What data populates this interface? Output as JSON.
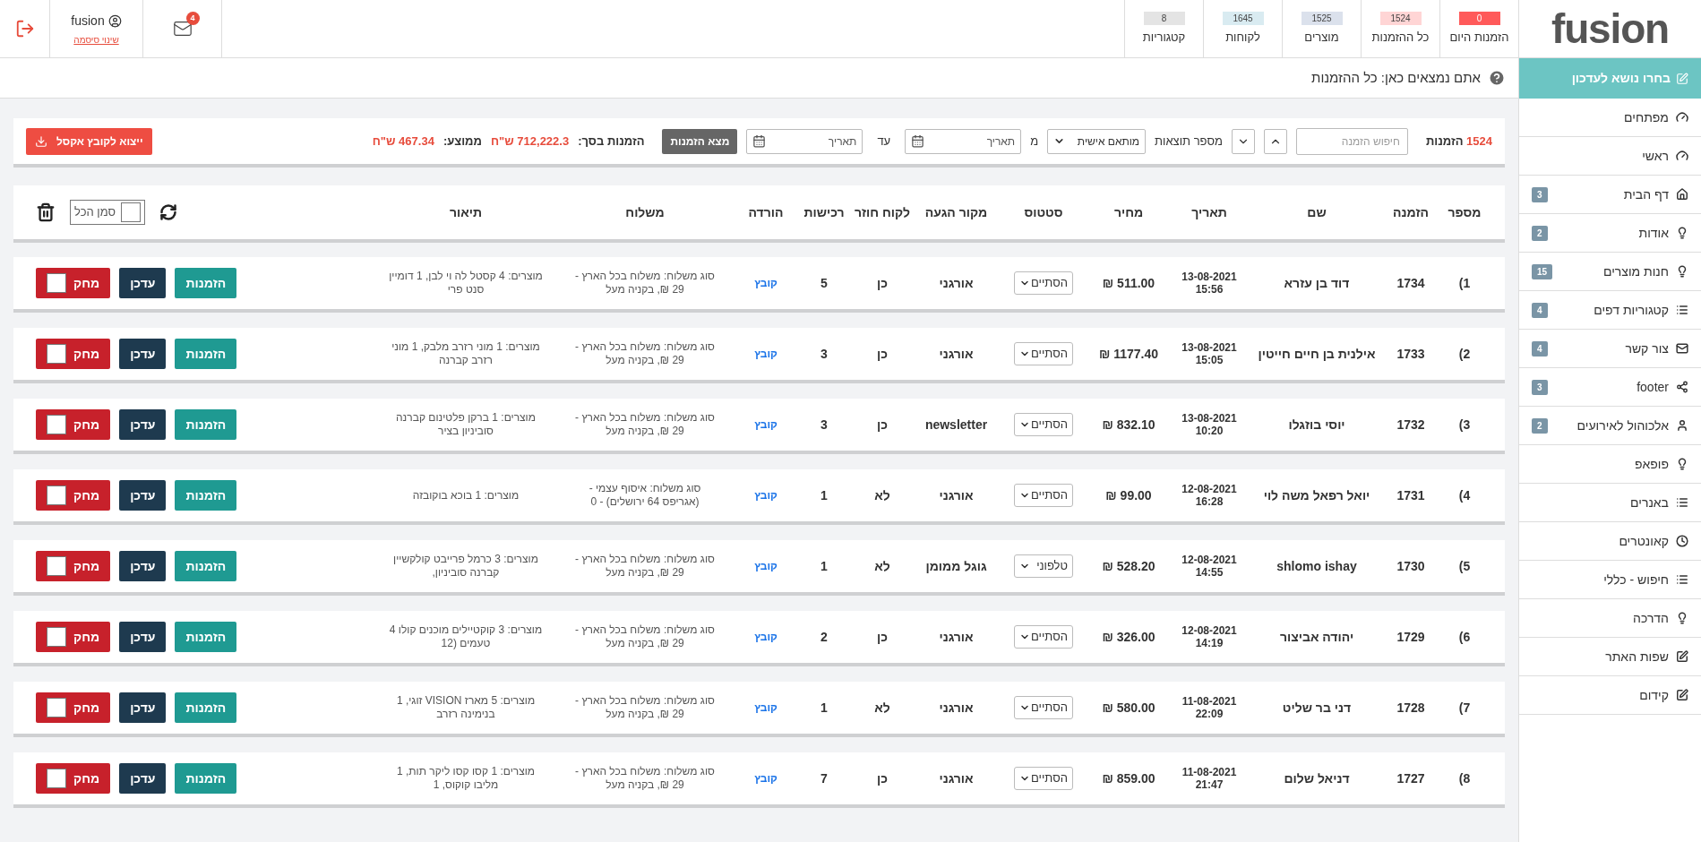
{
  "logo": "fusion",
  "stats": [
    {
      "label": "הזמנות היום",
      "value": "0",
      "color": "#ff5a5a"
    },
    {
      "label": "כל ההזמנות",
      "value": "1524",
      "color": "#ffd5d5"
    },
    {
      "label": "מוצרים",
      "value": "1525",
      "color": "#dbe1ec"
    },
    {
      "label": "לקוחות",
      "value": "1645",
      "color": "#d9ebf1"
    },
    {
      "label": "קטגוריות",
      "value": "8",
      "color": "#e4e4e4"
    }
  ],
  "user": {
    "name": "fusion",
    "link": "שינוי סיסמה"
  },
  "messages_badge": "4",
  "breadcrumb": "אתם נמצאים כאן: כל ההזמנות",
  "sidebar": {
    "title": "בחרו נושא לעדכון",
    "items": [
      {
        "label": "מפתחים",
        "kind": "dashboard"
      },
      {
        "label": "ראשי",
        "kind": "dashboard"
      },
      {
        "label": "דף הבית",
        "kind": "home",
        "badge": "3"
      },
      {
        "label": "אודות",
        "kind": "bulb",
        "badge": "2"
      },
      {
        "label": "חנות מוצרים",
        "kind": "bulb",
        "badge": "15"
      },
      {
        "label": "קטגוריות דפים",
        "kind": "list",
        "badge": "4"
      },
      {
        "label": "צור קשר",
        "kind": "mail",
        "badge": "4"
      },
      {
        "label": "footer",
        "kind": "share",
        "badge": "3"
      },
      {
        "label": "אלכוהול לאירועים",
        "kind": "user",
        "badge": "2"
      },
      {
        "label": "פופאפ",
        "kind": "bulb"
      },
      {
        "label": "באנרים",
        "kind": "list"
      },
      {
        "label": "קאונטרים",
        "kind": "clock"
      },
      {
        "label": "חיפוש - כללי",
        "kind": "list"
      },
      {
        "label": "הדרכה",
        "kind": "bulb"
      },
      {
        "label": "שפות האתר",
        "kind": "edit"
      },
      {
        "label": "קידום",
        "kind": "edit"
      }
    ]
  },
  "toolbar": {
    "count": "1524",
    "count_label": "הזמנות",
    "search_placeholder": "חיפוש הזמנה",
    "results_label": "מספר תוצאות",
    "results_select": "מותאם אישית",
    "from_label": "מ",
    "from_placeholder": "תאריך",
    "to_label": "עד",
    "to_placeholder": "תאריך",
    "find_button": "מצא הזמנות",
    "total_label": "הזמנות בסך:",
    "total_value": "712,222.3 ש\"ח",
    "average_label": "ממוצע:",
    "average_value": "467.34 ש\"ח",
    "export_button": "ייצוא לקובץ אקסל"
  },
  "table": {
    "columns": [
      "מספר",
      "הזמנה",
      "שם",
      "תאריך",
      "מחיר",
      "סטטוס",
      "מקור הגעה",
      "לקוח חוזר",
      "רכישות",
      "הורדה",
      "משלוח",
      "תיאור"
    ],
    "select_all": {
      "label": "סמן הכל",
      "checked": false
    },
    "rows": [
      {
        "index": "1)",
        "order": "1734",
        "name": "דוד בן עזרא",
        "date": "13-08-2021",
        "time": "15:56",
        "price": "511.00 ₪",
        "status": "הסתיים",
        "source": "אורגני",
        "returning": "כן",
        "purchases": "5",
        "download": "קובץ",
        "shipping": "סוג משלוח: משלוח בכל הארץ - 29 ₪, בקניה מעל",
        "description": "מוצרים: 4 קסטל לה וי לבן, 1 דומיין סנט פרי",
        "buttons": [
          "הזמנות",
          "עדכן",
          "מחק"
        ],
        "checked": false
      },
      {
        "index": "2)",
        "order": "1733",
        "name": "אילנית בן חיים חייטין",
        "date": "13-08-2021",
        "time": "15:05",
        "price": "1177.40 ₪",
        "status": "הסתיים",
        "source": "אורגני",
        "returning": "כן",
        "purchases": "3",
        "download": "קובץ",
        "shipping": "סוג משלוח: משלוח בכל הארץ - 29 ₪, בקניה מעל",
        "description": "מוצרים: 1 מוני רזרב מלבק, 1 מוני רזרב קברנה",
        "buttons": [
          "הזמנות",
          "עדכן",
          "מחק"
        ],
        "checked": false
      },
      {
        "index": "3)",
        "order": "1732",
        "name": "יוסי בוזגלו",
        "date": "13-08-2021",
        "time": "10:20",
        "price": "832.10 ₪",
        "status": "הסתיים",
        "source": "newsletter",
        "returning": "כן",
        "purchases": "3",
        "download": "קובץ",
        "shipping": "סוג משלוח: משלוח בכל הארץ - 29 ₪, בקניה מעל",
        "description": "מוצרים: 1 ברקן פלטינום קברנה סוביניון בציר",
        "buttons": [
          "הזמנות",
          "עדכן",
          "מחק"
        ],
        "checked": false
      },
      {
        "index": "4)",
        "order": "1731",
        "name": "יואל רפאל משה לוי",
        "date": "12-08-2021",
        "time": "16:28",
        "price": "99.00 ₪",
        "status": "הסתיים",
        "source": "אורגני",
        "returning": "לא",
        "purchases": "1",
        "download": "קובץ",
        "shipping": "סוג משלוח: איסוף עצמי - (אגריפס 64 ירושלים) - 0",
        "description": "מוצרים: 1 בוכא בוקובזה",
        "buttons": [
          "הזמנות",
          "עדכן",
          "מחק"
        ],
        "checked": false
      },
      {
        "index": "5)",
        "order": "1730",
        "name": "shlomo ishay",
        "date": "12-08-2021",
        "time": "14:55",
        "price": "528.20 ₪",
        "status": "טלפוני",
        "source": "גוגל ממומן",
        "returning": "לא",
        "purchases": "1",
        "download": "קובץ",
        "shipping": "סוג משלוח: משלוח בכל הארץ - 29 ₪, בקניה מעל",
        "description": "מוצרים: 3 כרמל פרייבט קולקשיין קברנה סוביניון,",
        "buttons": [
          "הזמנות",
          "עדכן",
          "מחק"
        ],
        "checked": false
      },
      {
        "index": "6)",
        "order": "1729",
        "name": "יהודה אביצור",
        "date": "12-08-2021",
        "time": "14:19",
        "price": "326.00 ₪",
        "status": "הסתיים",
        "source": "אורגני",
        "returning": "כן",
        "purchases": "2",
        "download": "קובץ",
        "shipping": "סוג משלוח: משלוח בכל הארץ - 29 ₪, בקניה מעל",
        "description": "מוצרים: 3 קוקטיילים מוכנים קולו 4 טעמים (12",
        "buttons": [
          "הזמנות",
          "עדכן",
          "מחק"
        ],
        "checked": false
      },
      {
        "index": "7)",
        "order": "1728",
        "name": "דני בר שליט",
        "date": "11-08-2021",
        "time": "22:09",
        "price": "580.00 ₪",
        "status": "הסתיים",
        "source": "אורגני",
        "returning": "לא",
        "purchases": "1",
        "download": "קובץ",
        "shipping": "סוג משלוח: משלוח בכל הארץ - 29 ₪, בקניה מעל",
        "description": "מוצרים: 5 מארז VISION זוגי, 1 בנימינה רזרב",
        "buttons": [
          "הזמנות",
          "עדכן",
          "מחק"
        ],
        "checked": false
      },
      {
        "index": "8)",
        "order": "1727",
        "name": "דניאל שלום",
        "date": "11-08-2021",
        "time": "21:47",
        "price": "859.00 ₪",
        "status": "הסתיים",
        "source": "אורגני",
        "returning": "כן",
        "purchases": "7",
        "download": "קובץ",
        "shipping": "סוג משלוח: משלוח בכל הארץ - 29 ₪, בקניה מעל",
        "description": "מוצרים: 1 קסו קסו ליקר תות, 1 מליבו קוקוס, 1",
        "buttons": [
          "הזמנות",
          "עדכן",
          "מחק"
        ],
        "checked": false
      }
    ]
  }
}
